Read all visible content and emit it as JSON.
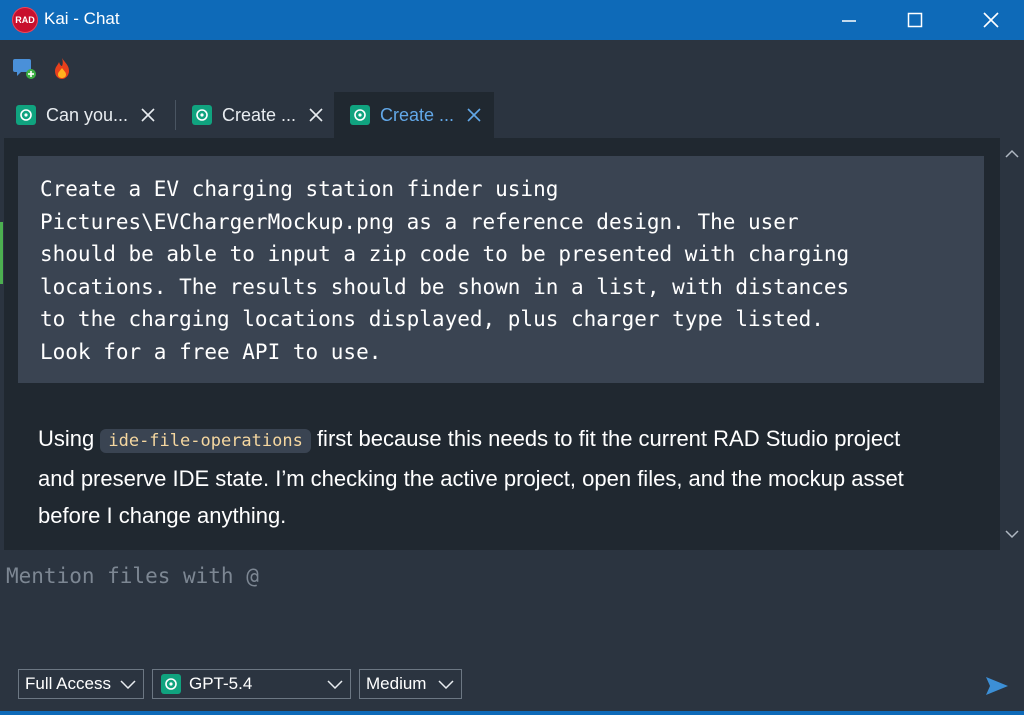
{
  "window": {
    "title": "Kai - Chat",
    "logo_text": "RAD",
    "accent_color": "#0e6ab8"
  },
  "toolbar": {
    "icons": [
      "new-chat-icon",
      "flame-icon"
    ]
  },
  "tabs": [
    {
      "label": "Can you...",
      "icon": "openai-icon",
      "active": false
    },
    {
      "label": "Create ...",
      "icon": "openai-icon",
      "active": false
    },
    {
      "label": "Create ...",
      "icon": "openai-icon",
      "active": true
    }
  ],
  "conversation": {
    "user_prompt": "Create a EV charging station finder using\nPictures\\EVChargerMockup.png as a reference design. The user\nshould be able to input a zip code to be presented with charging\nlocations. The results should be shown in a list, with distances\nto the charging locations displayed, plus charger type listed.\nLook for a free API to use.",
    "assistant_reply": {
      "prefix": "Using ",
      "code": "ide-file-operations",
      "suffix": " first because this needs to fit the current RAD Studio project and preserve IDE state. I’m checking the active project, open files, and the mockup asset before I change anything."
    }
  },
  "composer": {
    "placeholder": "Mention files with @",
    "value": "",
    "access_select": "Full Access",
    "model_select": "GPT-5.4",
    "effort_select": "Medium"
  }
}
